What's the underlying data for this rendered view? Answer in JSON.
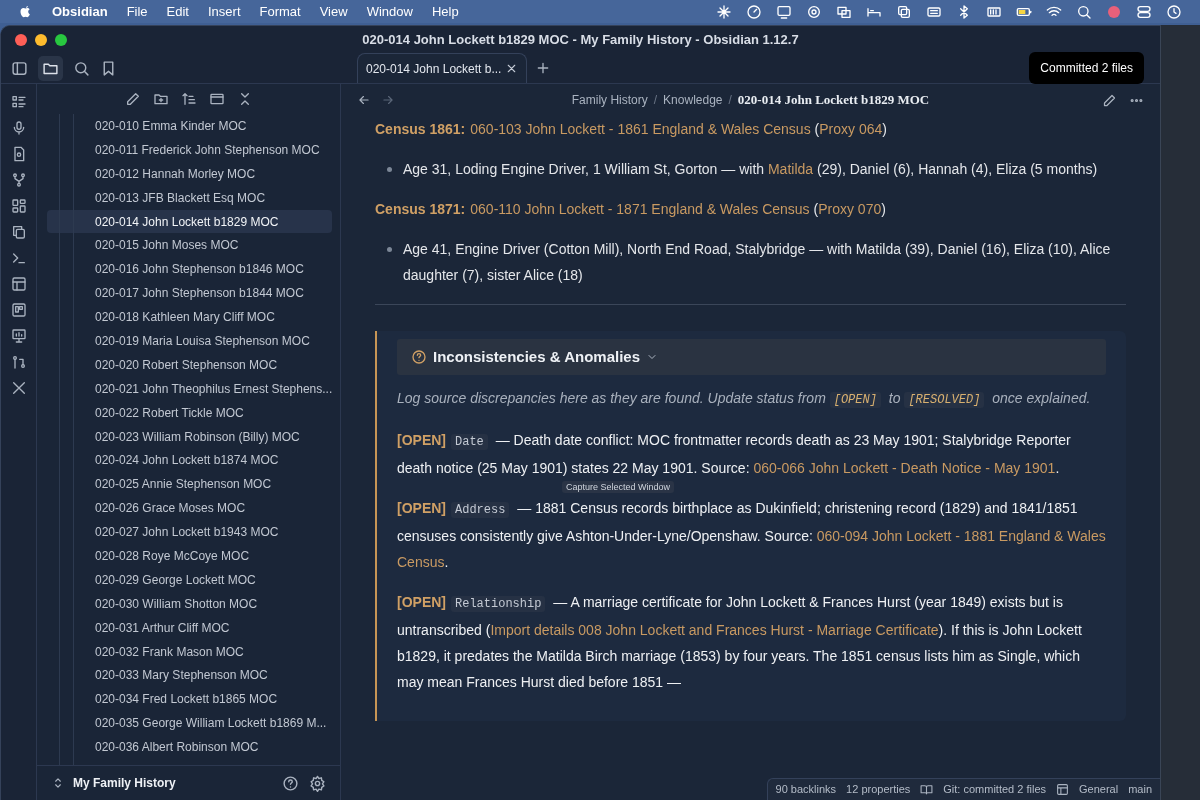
{
  "menubar": {
    "app": "Obsidian",
    "menus": [
      "File",
      "Edit",
      "Insert",
      "Format",
      "View",
      "Window",
      "Help"
    ]
  },
  "window": {
    "title": "020-014 John Lockett b1829 MOC - My Family History - Obsidian 1.12.7"
  },
  "tabs": [
    {
      "label": "020-014 John Lockett b...",
      "selected": true
    }
  ],
  "notification": "Committed 2 files",
  "breadcrumb": [
    "Family History",
    "Knowledge",
    "020-014 John Lockett b1829 MOC"
  ],
  "breadcrumb_separator": "/",
  "file_list": [
    {
      "label": "020-010 Emma Kinder MOC",
      "selected": false
    },
    {
      "label": "020-011 Frederick John Stephenson MOC",
      "selected": false
    },
    {
      "label": "020-012 Hannah Morley MOC",
      "selected": false
    },
    {
      "label": "020-013 JFB Blackett Esq MOC",
      "selected": false
    },
    {
      "label": "020-014 John Lockett b1829 MOC",
      "selected": true
    },
    {
      "label": "020-015 John Moses MOC",
      "selected": false
    },
    {
      "label": "020-016 John Stephenson b1846 MOC",
      "selected": false
    },
    {
      "label": "020-017 John Stephenson b1844 MOC",
      "selected": false
    },
    {
      "label": "020-018 Kathleen Mary Cliff MOC",
      "selected": false
    },
    {
      "label": "020-019 Maria Louisa Stephenson MOC",
      "selected": false
    },
    {
      "label": "020-020 Robert Stephenson MOC",
      "selected": false
    },
    {
      "label": "020-021 John Theophilus Ernest Stephens...",
      "selected": false
    },
    {
      "label": "020-022 Robert Tickle MOC",
      "selected": false
    },
    {
      "label": "020-023 William Robinson (Billy) MOC",
      "selected": false
    },
    {
      "label": "020-024 John Lockett b1874 MOC",
      "selected": false
    },
    {
      "label": "020-025 Annie Stephenson MOC",
      "selected": false
    },
    {
      "label": "020-026 Grace Moses MOC",
      "selected": false
    },
    {
      "label": "020-027 John Lockett b1943 MOC",
      "selected": false
    },
    {
      "label": "020-028 Roye McCoye MOC",
      "selected": false
    },
    {
      "label": "020-029 George Lockett MOC",
      "selected": false
    },
    {
      "label": "020-030 William Shotton MOC",
      "selected": false
    },
    {
      "label": "020-031 Arthur Cliff MOC",
      "selected": false
    },
    {
      "label": "020-032 Frank Mason MOC",
      "selected": false
    },
    {
      "label": "020-033 Mary Stephenson MOC",
      "selected": false
    },
    {
      "label": "020-034 Fred Lockett b1865 MOC",
      "selected": false
    },
    {
      "label": "020-035 George William Lockett b1869 M...",
      "selected": false
    },
    {
      "label": "020-036 Albert Robinson MOC",
      "selected": false
    }
  ],
  "vault": {
    "name": "My Family History"
  },
  "note": [
    {
      "kind": "para",
      "segments": [
        {
          "kind": "label",
          "text": "Census 1861:"
        },
        {
          "kind": "link",
          "text": "060-103 John Lockett - 1861 England & Wales Census"
        },
        {
          "kind": "text",
          "text": " ("
        },
        {
          "kind": "link",
          "text": "Proxy 064"
        },
        {
          "kind": "text",
          "text": ")"
        }
      ]
    },
    {
      "kind": "bullet",
      "segments": [
        {
          "kind": "text",
          "text": "Age 31, Loding Engine Driver, 1 William St, Gorton — with "
        },
        {
          "kind": "link",
          "text": "Matilda"
        },
        {
          "kind": "text",
          "text": " (29), Daniel (6), Hannah (4), Eliza (5 months)"
        }
      ]
    },
    {
      "kind": "para",
      "segments": [
        {
          "kind": "label",
          "text": "Census 1871:"
        },
        {
          "kind": "link",
          "text": "060-110 John Lockett - 1871 England & Wales Census"
        },
        {
          "kind": "text",
          "text": " ("
        },
        {
          "kind": "link",
          "text": "Proxy 070"
        },
        {
          "kind": "text",
          "text": ")"
        }
      ]
    },
    {
      "kind": "bullet",
      "segments": [
        {
          "kind": "text",
          "text": "Age 41, Engine Driver (Cotton Mill), North End Road, Stalybridge — with Matilda (39), Daniel (16), Eliza (10), Alice daughter (7), sister Alice (18)"
        }
      ]
    },
    {
      "kind": "rule"
    }
  ],
  "callout": {
    "title": "Inconsistencies & Anomalies",
    "intro": [
      {
        "kind": "text",
        "text": "Log source discrepancies here as they are found. Update status from "
      },
      {
        "kind": "code",
        "text": "[OPEN]"
      },
      {
        "kind": "text",
        "text": " to "
      },
      {
        "kind": "code",
        "text": "[RESOLVED]"
      },
      {
        "kind": "text",
        "text": " once explained."
      }
    ],
    "entries": [
      [
        {
          "kind": "label",
          "text": "[OPEN]"
        },
        {
          "kind": "code",
          "text": "Date"
        },
        {
          "kind": "text",
          "text": " — Death date conflict: MOC frontmatter records death as 23 May 1901; Stalybridge Reporter death notice (25 May 1901) states 22 May 1901. Source: "
        },
        {
          "kind": "link",
          "text": "060-066 John Lockett - Death Notice - May 1901"
        },
        {
          "kind": "text",
          "text": "."
        }
      ],
      [
        {
          "kind": "label",
          "text": "[OPEN]"
        },
        {
          "kind": "code",
          "text": "Address"
        },
        {
          "kind": "text",
          "text": " — 1881 Census records birthplace as Dukinfield; christening record (1829) and 1841/1851 censuses consistently give Ashton-Under-Lyne/Openshaw. Source: "
        },
        {
          "kind": "link",
          "text": "060-094 John Lockett - 1881 England & Wales Census"
        },
        {
          "kind": "text",
          "text": "."
        }
      ],
      [
        {
          "kind": "label",
          "text": "[OPEN]"
        },
        {
          "kind": "code",
          "text": "Relationship"
        },
        {
          "kind": "text",
          "text": " — A marriage certificate for John Lockett & Frances Hurst (year 1849) exists but is untranscribed ("
        },
        {
          "kind": "link",
          "text": "Import details 008 John Lockett and Frances Hurst - Marriage Certificate"
        },
        {
          "kind": "text",
          "text": "). If this is John Lockett b1829, it predates the Matilda Birch marriage (1853) by four years. The 1851 census lists him as Single, which may mean Frances Hurst died before 1851 —"
        }
      ]
    ]
  },
  "tooltip": "Capture Selected Window",
  "status_bar": [
    "90 backlinks",
    "12 properties",
    "Git: committed 2 files",
    "General",
    "main"
  ]
}
